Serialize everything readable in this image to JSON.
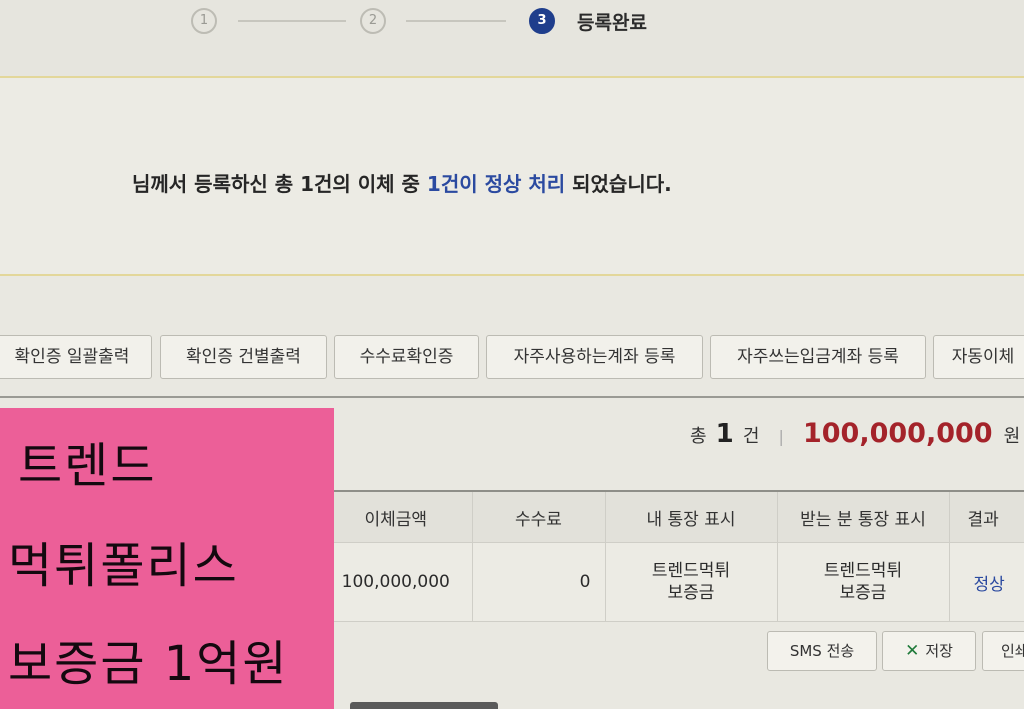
{
  "stepper": {
    "steps": [
      "1",
      "2",
      "3"
    ],
    "active_label": "등록완료"
  },
  "message": {
    "prefix": "님께서 등록하신 총 1건의 이체 중 ",
    "highlight": "1건이 정상 처리",
    "suffix": " 되었습니다."
  },
  "actions": [
    "확인증 일괄출력",
    "확인증 건별출력",
    "수수료확인증",
    "자주사용하는계좌 등록",
    "자주쓰는입금계좌 등록",
    "자동이체"
  ],
  "summary": {
    "total_prefix": "총",
    "count": "1",
    "count_unit": "건",
    "separator": "|",
    "amount": "100,000,000",
    "amount_unit": "원"
  },
  "table": {
    "headers": [
      "이체금액",
      "수수료",
      "내 통장 표시",
      "받는 분 통장 표시",
      "결과"
    ],
    "rows": [
      {
        "amount": "100,000,000",
        "fee": "0",
        "my_display_line1": "트렌드먹튀",
        "my_display_line2": "보증금",
        "recipient_display_line1": "트렌드먹튀",
        "recipient_display_line2": "보증금",
        "result": "정상"
      }
    ]
  },
  "bottom_buttons": {
    "sms": "SMS 전송",
    "save": "저장",
    "print": "인쇄"
  },
  "sticky_note": {
    "line1": "트렌드",
    "line2": "먹튀폴리스",
    "line3": "보증금 1억원"
  },
  "colors": {
    "accent_blue": "#2b4aa0",
    "amount_red": "#a4232a",
    "sticky_pink": "#ec5f98",
    "excel_green": "#1f7a3a"
  }
}
